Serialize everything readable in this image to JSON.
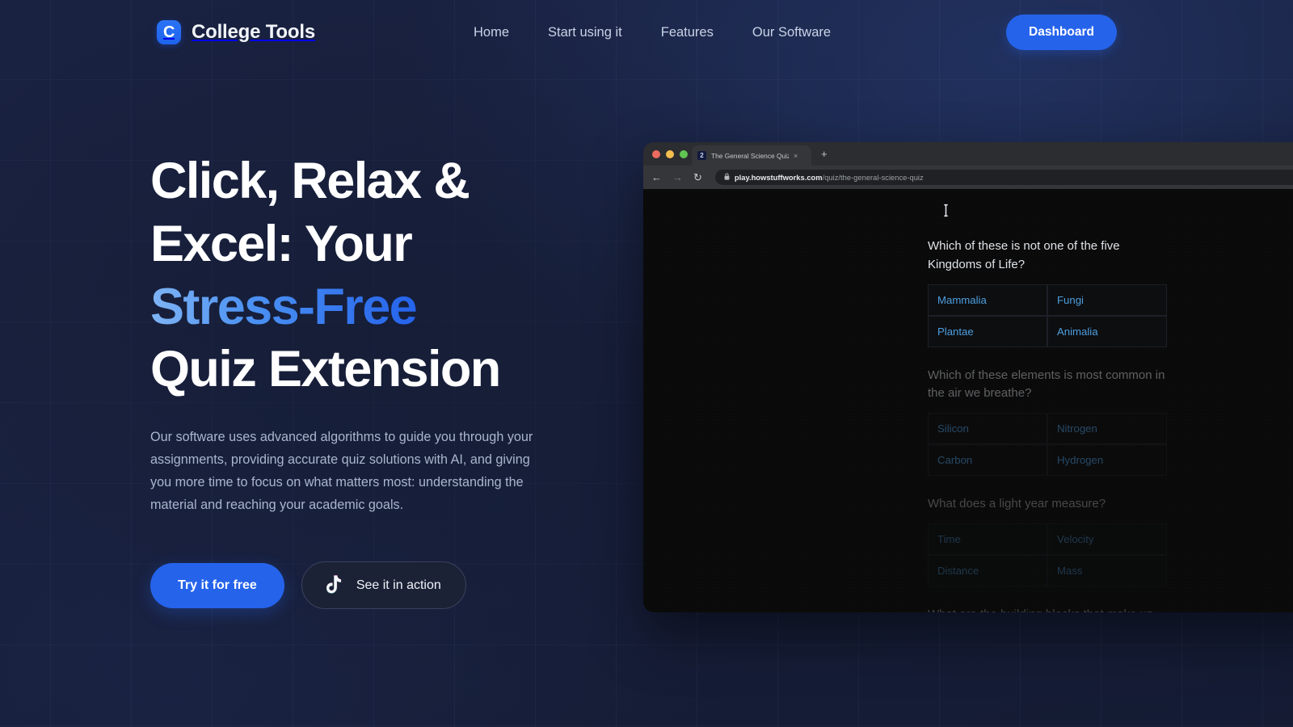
{
  "brand": {
    "mark_letter": "C",
    "name": "College Tools"
  },
  "nav": {
    "links": [
      {
        "label": "Home"
      },
      {
        "label": "Start using it"
      },
      {
        "label": "Features"
      },
      {
        "label": "Our Software"
      }
    ],
    "dashboard_label": "Dashboard"
  },
  "hero": {
    "headline_line1": "Click, Relax &",
    "headline_line2": "Excel: Your",
    "headline_accent": "Stress-Free",
    "headline_line4": "Quiz Extension",
    "paragraph": "Our software uses advanced algorithms to guide you through your assignments, providing accurate quiz solutions with AI, and giving you more time to focus on what matters most: understanding the material and reaching your academic goals.",
    "primary_cta": "Try it for free",
    "secondary_cta": "See it in action"
  },
  "browser": {
    "tab": {
      "favicon_letter": "2",
      "title": "The General Science Quiz | Ho",
      "close_glyph": "×"
    },
    "new_tab_glyph": "+",
    "toolbar": {
      "back_glyph": "←",
      "forward_glyph": "→",
      "reload_glyph": "↻",
      "lock_glyph": "🔒",
      "url_domain": "play.howstuffworks.com",
      "url_path": "/quiz/the-general-science-quiz",
      "install_glyph": "⬇"
    }
  },
  "quiz": {
    "questions": [
      {
        "text": "Which of these is not one of the five Kingdoms of Life?",
        "answers": [
          "Mammalia",
          "Fungi",
          "Plantae",
          "Animalia"
        ]
      },
      {
        "text": "Which of these elements is most common in the air we breathe?",
        "answers": [
          "Silicon",
          "Nitrogen",
          "Carbon",
          "Hydrogen"
        ]
      },
      {
        "text": "What does a light year measure?",
        "answers": [
          "Time",
          "Velocity",
          "Distance",
          "Mass"
        ]
      },
      {
        "text": "What are the building blocks that make up everything on Earth called?",
        "answers": []
      }
    ]
  },
  "colors": {
    "accent_blue": "#2563eb",
    "page_bg": "#18203c",
    "answer_text": "#4d9fe0",
    "quiz_bg": "#0a0a0a"
  }
}
